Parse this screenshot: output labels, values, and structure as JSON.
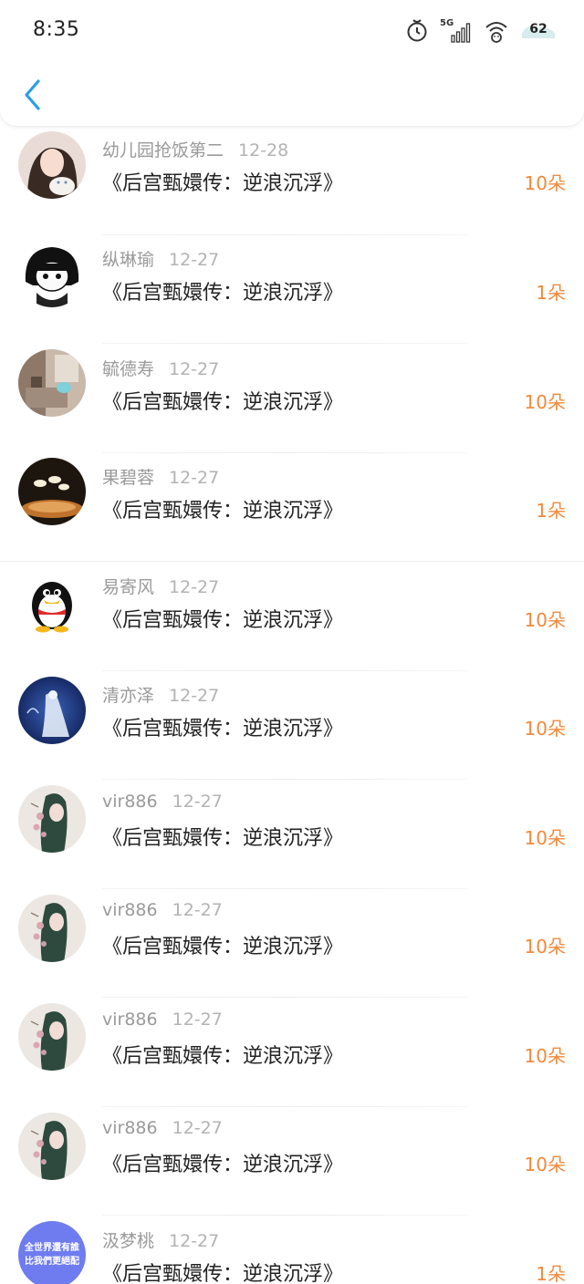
{
  "status_bar": {
    "time": "8:35",
    "network": "5G",
    "battery": "62",
    "icons": [
      "timer-icon",
      "signal-5g-icon",
      "wifi-icon",
      "battery-icon"
    ]
  },
  "nav": {
    "back_icon": "chevron-left-icon"
  },
  "colors": {
    "accent": "#f08a3c",
    "back": "#2b9ee8",
    "name": "#9a9a9a"
  },
  "gifts": [
    {
      "user": "幼儿园抢饭第二",
      "date": "12-28",
      "title": "《后宫甄嬛传：逆浪沉浮》",
      "amount": "10朵",
      "avatar": "avatar-girl-with-cat"
    },
    {
      "user": "纵琳瑜",
      "date": "12-27",
      "title": "《后宫甄嬛传：逆浪沉浮》",
      "amount": "1朵",
      "avatar": "avatar-cartoon-bob-hair"
    },
    {
      "user": "毓德寿",
      "date": "12-27",
      "title": "《后宫甄嬛传：逆浪沉浮》",
      "amount": "10朵",
      "avatar": "avatar-room-photo"
    },
    {
      "user": "果碧蓉",
      "date": "12-27",
      "title": "《后宫甄嬛传：逆浪沉浮》",
      "amount": "1朵",
      "avatar": "avatar-lamp-photo"
    },
    {
      "user": "易寄风",
      "date": "12-27",
      "title": "《后宫甄嬛传：逆浪沉浮》",
      "amount": "10朵",
      "avatar": "avatar-penguin"
    },
    {
      "user": "清亦泽",
      "date": "12-27",
      "title": "《后宫甄嬛传：逆浪沉浮》",
      "amount": "10朵",
      "avatar": "avatar-night-figure"
    },
    {
      "user": "vir886",
      "date": "12-27",
      "title": "《后宫甄嬛传：逆浪沉浮》",
      "amount": "10朵",
      "avatar": "avatar-ink-painting"
    },
    {
      "user": "vir886",
      "date": "12-27",
      "title": "《后宫甄嬛传：逆浪沉浮》",
      "amount": "10朵",
      "avatar": "avatar-ink-painting"
    },
    {
      "user": "vir886",
      "date": "12-27",
      "title": "《后宫甄嬛传：逆浪沉浮》",
      "amount": "10朵",
      "avatar": "avatar-ink-painting"
    },
    {
      "user": "vir886",
      "date": "12-27",
      "title": "《后宫甄嬛传：逆浪沉浮》",
      "amount": "10朵",
      "avatar": "avatar-ink-painting"
    },
    {
      "user": "汲梦桃",
      "date": "12-27",
      "title": "《后宫甄嬛传：逆浪沉浮》",
      "amount": "1朵",
      "avatar": "avatar-text-badge",
      "avatar_text": [
        "全世界還有誰",
        "比我們更絕配"
      ]
    }
  ]
}
